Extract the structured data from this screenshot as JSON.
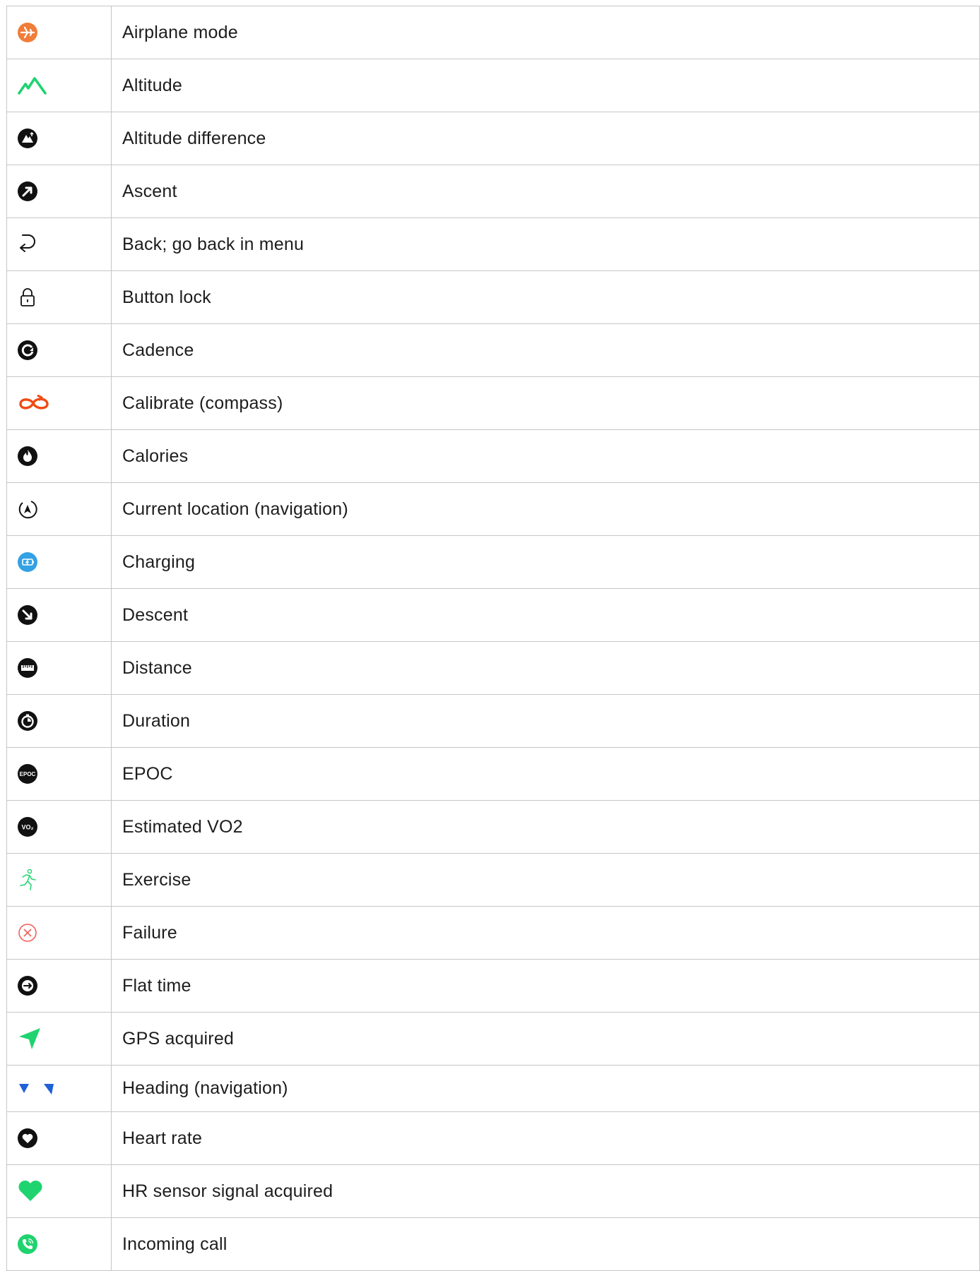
{
  "colors": {
    "border": "#c6c6c6",
    "orange": "#f07d3a",
    "green": "#1fd36f",
    "black": "#111111",
    "red_orange": "#ee4b16",
    "blue": "#33a1e3",
    "heading_blue": "#1f5fd8",
    "failure_red": "#f0605a"
  },
  "rows": [
    {
      "icon": "airplane-mode-icon",
      "label": "Airplane mode"
    },
    {
      "icon": "altitude-icon",
      "label": "Altitude"
    },
    {
      "icon": "altitude-difference-icon",
      "label": "Altitude difference"
    },
    {
      "icon": "ascent-icon",
      "label": "Ascent"
    },
    {
      "icon": "back-icon",
      "label": "Back; go back in menu"
    },
    {
      "icon": "button-lock-icon",
      "label": "Button lock"
    },
    {
      "icon": "cadence-icon",
      "label": "Cadence"
    },
    {
      "icon": "calibrate-compass-icon",
      "label": "Calibrate (compass)"
    },
    {
      "icon": "calories-icon",
      "label": "Calories"
    },
    {
      "icon": "current-location-icon",
      "label": "Current location (navigation)"
    },
    {
      "icon": "charging-icon",
      "label": "Charging"
    },
    {
      "icon": "descent-icon",
      "label": "Descent"
    },
    {
      "icon": "distance-icon",
      "label": "Distance"
    },
    {
      "icon": "duration-icon",
      "label": "Duration"
    },
    {
      "icon": "epoc-icon",
      "label": "EPOC",
      "icon_text": "EPOC"
    },
    {
      "icon": "estimated-vo2-icon",
      "label": "Estimated VO2",
      "icon_text": "VO₂"
    },
    {
      "icon": "exercise-icon",
      "label": "Exercise"
    },
    {
      "icon": "failure-icon",
      "label": "Failure"
    },
    {
      "icon": "flat-time-icon",
      "label": "Flat time"
    },
    {
      "icon": "gps-acquired-icon",
      "label": "GPS acquired"
    },
    {
      "icon": "heading-icon",
      "label": "Heading (navigation)"
    },
    {
      "icon": "heart-rate-icon",
      "label": "Heart rate"
    },
    {
      "icon": "hr-sensor-signal-icon",
      "label": "HR sensor signal acquired"
    },
    {
      "icon": "incoming-call-icon",
      "label": "Incoming call"
    }
  ]
}
